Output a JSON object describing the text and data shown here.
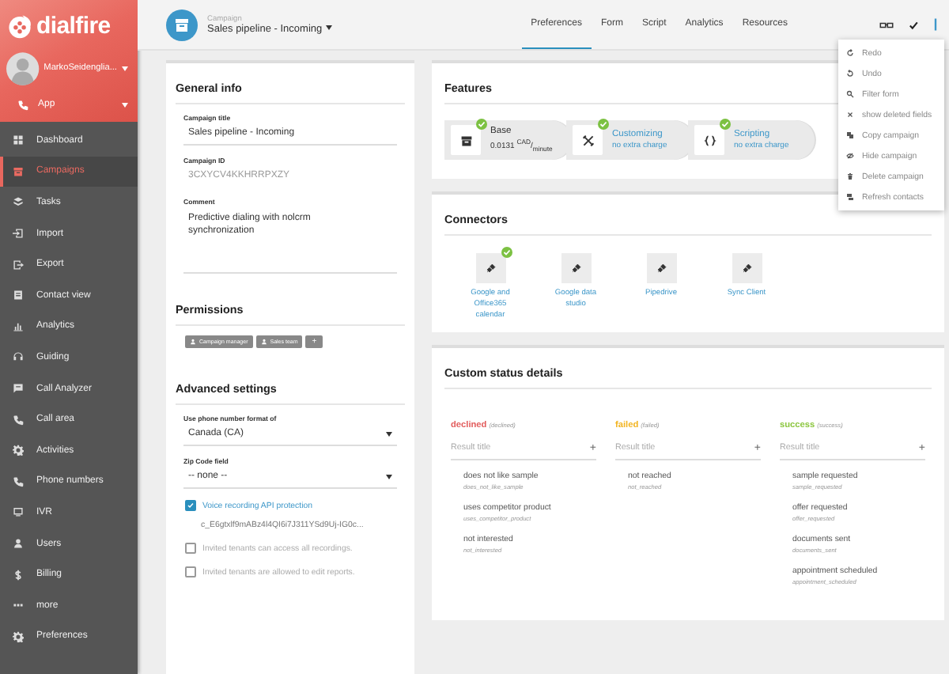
{
  "sidebar": {
    "brand": "dialfire",
    "user": "MarkoSeidenglia...",
    "app": "App",
    "items": [
      {
        "label": "Dashboard",
        "selected": false
      },
      {
        "label": "Campaigns",
        "selected": true
      },
      {
        "label": "Tasks",
        "selected": false
      },
      {
        "label": "Import",
        "selected": false
      },
      {
        "label": "Export",
        "selected": false
      },
      {
        "label": "Contact view",
        "selected": false
      },
      {
        "label": "Analytics",
        "selected": false
      },
      {
        "label": "Guiding",
        "selected": false
      },
      {
        "label": "Call Analyzer",
        "selected": false
      },
      {
        "label": "Call area",
        "selected": false
      },
      {
        "label": "Activities",
        "selected": false
      },
      {
        "label": "Phone numbers",
        "selected": false
      },
      {
        "label": "IVR",
        "selected": false
      },
      {
        "label": "Users",
        "selected": false
      },
      {
        "label": "Billing",
        "selected": false
      },
      {
        "label": "more",
        "selected": false
      },
      {
        "label": "Preferences",
        "selected": false
      }
    ]
  },
  "header": {
    "section": "Campaign",
    "title": "Sales pipeline - Incoming",
    "tabs": [
      {
        "label": "Preferences",
        "selected": true
      },
      {
        "label": "Form",
        "selected": false
      },
      {
        "label": "Script",
        "selected": false
      },
      {
        "label": "Analytics",
        "selected": false
      },
      {
        "label": "Resources",
        "selected": false
      }
    ]
  },
  "menu": {
    "items": [
      "Redo",
      "Undo",
      "Filter form",
      "show deleted fields",
      "Copy campaign",
      "Hide campaign",
      "Delete campaign",
      "Refresh contacts"
    ]
  },
  "general_info": {
    "title": "General info",
    "fields": [
      {
        "kind": "text",
        "label": "Campaign title",
        "value": "Sales pipeline - Incoming"
      },
      {
        "kind": "readonly",
        "label": "Campaign ID",
        "value": "3CXYCV4KKHRRPXZY"
      },
      {
        "kind": "textarea",
        "label": "Comment",
        "value": "Predictive dialing with nolcrm synchronization"
      }
    ]
  },
  "permissions": {
    "title": "Permissions",
    "tags": [
      "Campaign manager",
      "Sales team"
    ],
    "add": "+"
  },
  "advanced": {
    "title": "Advanced settings",
    "selects": [
      {
        "label": "Use phone number format of",
        "value": "Canada (CA)"
      },
      {
        "label": "Zip Code field",
        "value": "-- none --"
      }
    ],
    "options": [
      {
        "label": "Voice recording API protection",
        "checked": true,
        "detail": "c_E6gtxlf9mABz4l4QI6i7J311YSd9Uj-IG0c..."
      },
      {
        "label": "Invited tenants can access all recordings.",
        "checked": false
      },
      {
        "label": "Invited tenants are allowed to edit reports.",
        "checked": false
      }
    ]
  },
  "features": {
    "title": "Features",
    "items": [
      {
        "kind": "base",
        "name": "Base",
        "note": "0.0131 $^{CAD}$/$_{minute}$",
        "active": true
      },
      {
        "kind": "addon",
        "name": "Customizing",
        "note": "no extra charge",
        "active": true
      },
      {
        "kind": "addon",
        "name": "Scripting",
        "note": "no extra charge",
        "active": true
      }
    ]
  },
  "connectors": {
    "title": "Connectors",
    "items": [
      {
        "label": "Google and Office365 calendar",
        "active": true
      },
      {
        "label": "Google data studio",
        "active": false
      },
      {
        "label": "Pipedrive",
        "active": false
      },
      {
        "label": "Sync Client",
        "active": false
      }
    ]
  },
  "custom_status": {
    "title": "Custom status details",
    "columns": [
      {
        "name": "declined",
        "key": "(declined)",
        "color": "#e25c5c",
        "placeholder": "Result title",
        "add": "+",
        "results": [
          {
            "title": "does not like sample",
            "key": "does_not_like_sample"
          },
          {
            "title": "uses competitor product",
            "key": "uses_competitor_product"
          },
          {
            "title": "not interested",
            "key": "not_interested"
          }
        ]
      },
      {
        "name": "failed",
        "key": "(failed)",
        "color": "#f2b420",
        "placeholder": "Result title",
        "add": "+",
        "results": [
          {
            "title": "not reached",
            "key": "not_reached"
          }
        ]
      },
      {
        "name": "success",
        "key": "(success)",
        "color": "#8cc63f",
        "placeholder": "Result title",
        "add": "+",
        "results": [
          {
            "title": "sample requested",
            "key": "sample_requested"
          },
          {
            "title": "offer requested",
            "key": "offer_requested"
          },
          {
            "title": "documents sent",
            "key": "documents_sent"
          },
          {
            "title": "appointment scheduled",
            "key": "appointment_scheduled"
          }
        ]
      }
    ]
  }
}
